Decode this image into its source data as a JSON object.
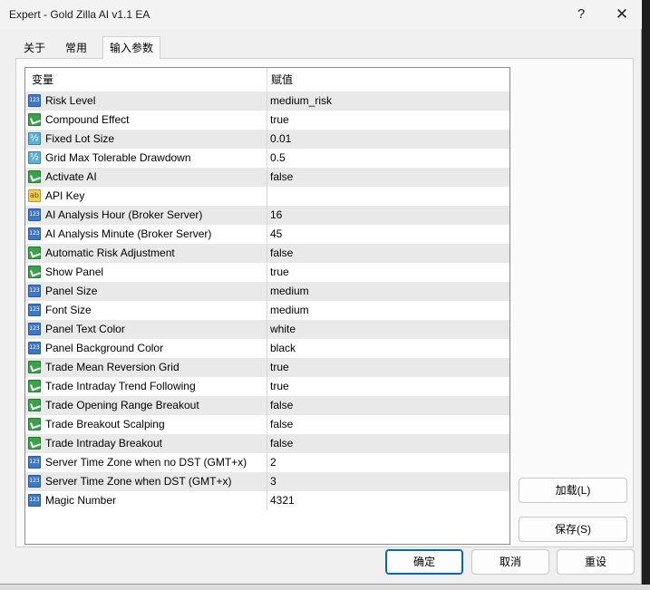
{
  "window": {
    "title": "Expert - Gold Zilla AI v1.1 EA",
    "help": "?",
    "close": "✕"
  },
  "tabs": [
    {
      "label": "关于",
      "active": false
    },
    {
      "label": "常用",
      "active": false
    },
    {
      "label": "输入参数",
      "active": true
    }
  ],
  "table": {
    "columns": {
      "variable": "变量",
      "value": "赋值"
    },
    "rows": [
      {
        "name": "Risk Level",
        "value": "medium_risk",
        "icon": "number-icon"
      },
      {
        "name": "Compound Effect",
        "value": "true",
        "icon": "bool-icon"
      },
      {
        "name": "Fixed Lot Size",
        "value": "0.01",
        "icon": "double-icon"
      },
      {
        "name": "Grid Max Tolerable Drawdown",
        "value": "0.5",
        "icon": "double-icon"
      },
      {
        "name": "Activate AI",
        "value": "false",
        "icon": "bool-icon"
      },
      {
        "name": "API Key",
        "value": "",
        "icon": "string-icon"
      },
      {
        "name": "AI Analysis Hour (Broker Server)",
        "value": "16",
        "icon": "number-icon"
      },
      {
        "name": "AI Analysis Minute (Broker Server)",
        "value": "45",
        "icon": "number-icon"
      },
      {
        "name": "Automatic Risk Adjustment",
        "value": "false",
        "icon": "bool-icon"
      },
      {
        "name": "Show Panel",
        "value": "true",
        "icon": "bool-icon"
      },
      {
        "name": "Panel Size",
        "value": "medium",
        "icon": "number-icon"
      },
      {
        "name": "Font Size",
        "value": "medium",
        "icon": "number-icon"
      },
      {
        "name": "Panel Text Color",
        "value": "white",
        "icon": "number-icon"
      },
      {
        "name": "Panel Background Color",
        "value": "black",
        "icon": "number-icon"
      },
      {
        "name": "Trade Mean Reversion Grid",
        "value": "true",
        "icon": "bool-icon"
      },
      {
        "name": "Trade Intraday Trend Following",
        "value": "true",
        "icon": "bool-icon"
      },
      {
        "name": "Trade Opening Range Breakout",
        "value": "false",
        "icon": "bool-icon"
      },
      {
        "name": "Trade Breakout Scalping",
        "value": "false",
        "icon": "bool-icon"
      },
      {
        "name": "Trade Intraday Breakout",
        "value": "false",
        "icon": "bool-icon"
      },
      {
        "name": "Server Time Zone when no DST (GMT+x)",
        "value": "2",
        "icon": "number-icon"
      },
      {
        "name": "Server Time Zone when DST (GMT+x)",
        "value": "3",
        "icon": "number-icon"
      },
      {
        "name": "Magic Number",
        "value": "4321",
        "icon": "number-icon"
      }
    ]
  },
  "buttons": {
    "load": "加载(L)",
    "save": "保存(S)",
    "ok": "确定",
    "cancel": "取消",
    "reset": "重设"
  },
  "colors": {
    "accent": "#0067c0",
    "row_alt": "#e9e9e9"
  }
}
